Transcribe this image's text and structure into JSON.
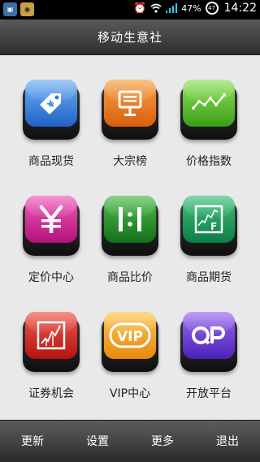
{
  "status_bar": {
    "battery": "47%",
    "battery_ring": "47",
    "time": "14:22",
    "icons": [
      "notification-app-icon",
      "notification-app-icon-2",
      "alarm-icon",
      "wifi-icon",
      "signal-icon",
      "battery-icon"
    ]
  },
  "title_bar": {
    "title": "移动生意社"
  },
  "grid": {
    "items": [
      {
        "label": "商品现货",
        "icon": "price-tag-yen-icon",
        "color": "#2f7ee0"
      },
      {
        "label": "大宗榜",
        "icon": "billboard-icon",
        "color": "#e8741e"
      },
      {
        "label": "价格指数",
        "icon": "line-chart-icon",
        "color": "#5cc22f"
      },
      {
        "label": "定价中心",
        "icon": "yen-icon",
        "color": "#d4279a"
      },
      {
        "label": "商品比价",
        "icon": "compare-icon",
        "color": "#2e8f2f"
      },
      {
        "label": "商品期货",
        "icon": "futures-chart-icon",
        "color": "#22a05c"
      },
      {
        "label": "证券机会",
        "icon": "stock-chart-icon",
        "color": "#d8322a"
      },
      {
        "label": "VIP中心",
        "icon": "vip-icon",
        "color": "#f3a123"
      },
      {
        "label": "开放平台",
        "icon": "open-platform-icon",
        "color": "#6d42d6"
      }
    ],
    "vip_text": "VIP"
  },
  "bottom_bar": {
    "refresh": "更新",
    "settings": "设置",
    "more": "更多",
    "exit": "退出"
  }
}
